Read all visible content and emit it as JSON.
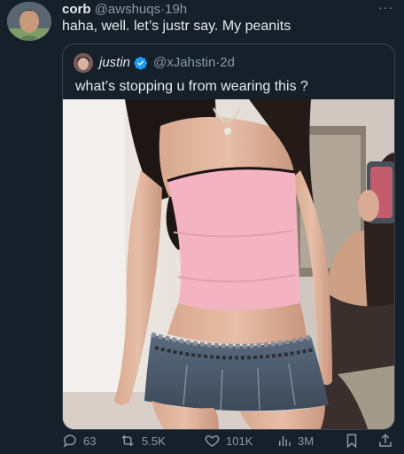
{
  "tweet": {
    "author_name": "corb",
    "author_handle": "@awshuqs",
    "time": "19h",
    "text": "haha, well. let’s justr say. My peanits",
    "more_label": "···"
  },
  "quoted": {
    "author_name": "justin",
    "author_handle": "@xJahstin",
    "time": "2d",
    "text": "what’s stopping u from wearing this ?"
  },
  "actions": {
    "replies": "63",
    "reposts": "5.5K",
    "likes": "101K",
    "views": "3M"
  },
  "colors": {
    "background": "#15202b",
    "muted": "#8b98a5",
    "verified": "#1d9bf0",
    "border": "#38444d"
  },
  "icons": [
    "reply-icon",
    "repost-icon",
    "like-icon",
    "views-icon",
    "bookmark-icon",
    "share-icon",
    "verified-icon",
    "more-icon"
  ]
}
